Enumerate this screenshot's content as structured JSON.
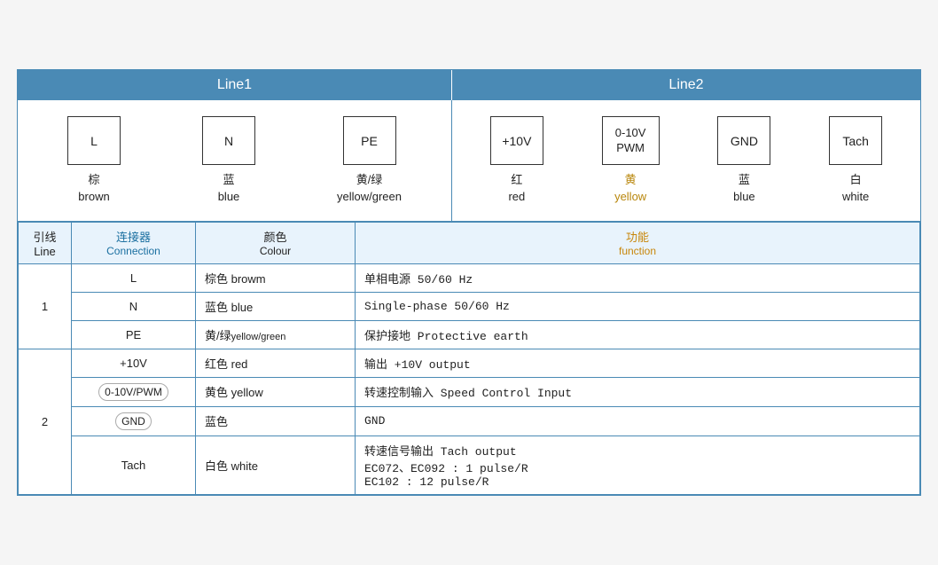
{
  "header": {
    "line1_label": "Line1",
    "line2_label": "Line2"
  },
  "diagram": {
    "line1_connectors": [
      {
        "id": "L",
        "label_cn": "棕",
        "label_en": "brown"
      },
      {
        "id": "N",
        "label_cn": "蓝",
        "label_en": "blue"
      },
      {
        "id": "PE",
        "label_cn": "黄/绿",
        "label_en": "yellow/green"
      }
    ],
    "line2_connectors": [
      {
        "id": "+10V",
        "label_cn": "红",
        "label_en": "red"
      },
      {
        "id": "0-10V\nPWM",
        "label_cn": "黄",
        "label_en": "yellow"
      },
      {
        "id": "GND",
        "label_cn": "蓝",
        "label_en": "blue"
      },
      {
        "id": "Tach",
        "label_cn": "白",
        "label_en": "white"
      }
    ]
  },
  "table": {
    "headers": {
      "line_cn": "引线",
      "line_en": "Line",
      "conn_cn": "连接器",
      "conn_en": "Connection",
      "colour_cn": "颜色",
      "colour_en": "Colour",
      "func_cn": "功能",
      "func_en": "function"
    },
    "rows": [
      {
        "line": "1",
        "rowspan": 3,
        "entries": [
          {
            "conn": "L",
            "colour_cn": "棕色",
            "colour_en": "browm",
            "func": "单相电源 50/60 Hz"
          },
          {
            "conn": "N",
            "colour_cn": "蓝色",
            "colour_en": "blue",
            "func": "Single-phase 50/60 Hz"
          },
          {
            "conn": "PE",
            "colour_cn": "黄/绿",
            "colour_en": "yellow/green",
            "func": "保护接地 Protective earth"
          }
        ]
      },
      {
        "line": "2",
        "rowspan": 4,
        "entries": [
          {
            "conn": "+10V",
            "colour_cn": "红色",
            "colour_en": "red",
            "func": "输出 +10V output"
          },
          {
            "conn": "0-10V/PWM",
            "colour_cn": "黄色",
            "colour_en": "yellow",
            "func": "转速控制输入 Speed Control Input",
            "conn_rounded": true
          },
          {
            "conn": "GND",
            "colour_cn": "蓝色",
            "colour_en": "",
            "func": "GND",
            "conn_rounded": true
          },
          {
            "conn": "Tach",
            "colour_cn": "白色",
            "colour_en": "white",
            "func_multi": [
              "转速信号输出 Tach output",
              "EC072、EC092 : 1 pulse/R",
              "EC102 : 12 pulse/R"
            ]
          }
        ]
      }
    ]
  }
}
